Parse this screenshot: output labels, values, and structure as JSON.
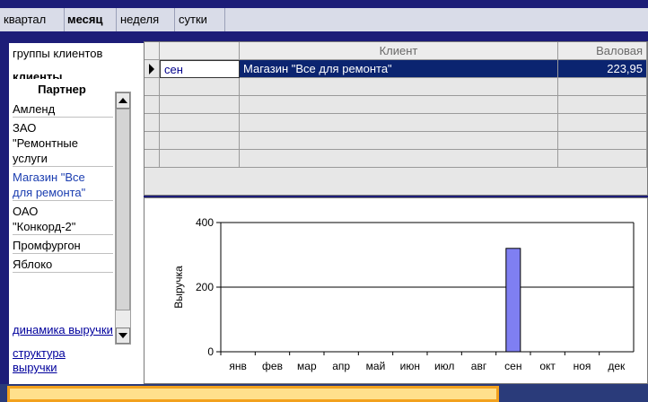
{
  "period_tabs": [
    {
      "label": "квартал",
      "active": false
    },
    {
      "label": "месяц",
      "active": true
    },
    {
      "label": "неделя",
      "active": false
    },
    {
      "label": "сутки",
      "active": false
    }
  ],
  "left_panel": {
    "groups_label": "группы клиентов",
    "clients_label": "клиенты",
    "partner_header": "Партнер",
    "partners": [
      [
        "Амленд"
      ],
      [
        "ЗАО",
        "\"Ремонтные",
        "услуги"
      ],
      [
        "Магазин \"Все",
        "для ремонта\""
      ],
      [
        "ОАО",
        "\"Конкорд-2\""
      ],
      [
        "Промфургон"
      ],
      [
        "Яблоко"
      ]
    ],
    "selected_partner_index": 2,
    "links": [
      [
        "динамика выручки"
      ],
      [
        "структура",
        "выручки"
      ]
    ]
  },
  "grid": {
    "headers": {
      "period": "",
      "client": "Клиент",
      "gross": "Валовая"
    },
    "rows": [
      {
        "period": "сен",
        "client": "Магазин \"Все для ремонта\"",
        "gross": "223,95"
      }
    ]
  },
  "chart_data": {
    "type": "bar",
    "categories": [
      "янв",
      "фев",
      "мар",
      "апр",
      "май",
      "июн",
      "июл",
      "авг",
      "сен",
      "окт",
      "ноя",
      "дек"
    ],
    "values": [
      0,
      0,
      0,
      0,
      0,
      0,
      0,
      0,
      320,
      0,
      0,
      0
    ],
    "ylabel": "Выручка",
    "ylim": [
      0,
      400
    ],
    "yticks": [
      0,
      200,
      400
    ],
    "bar_color": "#7f7ff2"
  },
  "colors": {
    "background": "#1d1d78",
    "selection": "#0b2470",
    "status_fill": "#ffe08c",
    "status_border": "#f2a11d"
  }
}
